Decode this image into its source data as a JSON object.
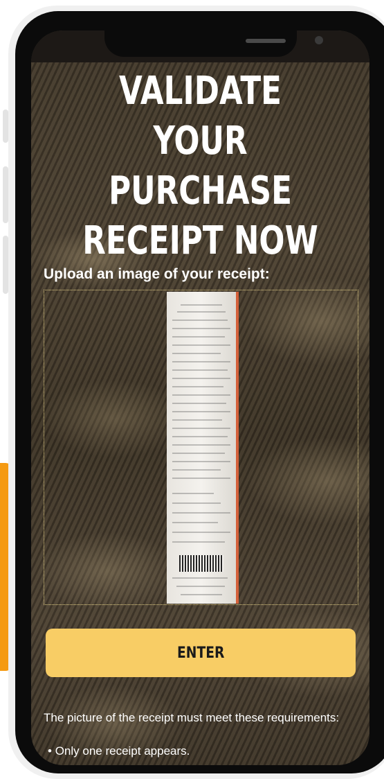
{
  "page": {
    "title_lines": [
      "VALIDATE YOUR",
      "PURCHASE",
      "RECEIPT NOW"
    ],
    "upload_label": "Upload an image of your receipt:",
    "enter_button_label": "ENTER",
    "requirements_intro": "The picture of the receipt must meet these requirements:",
    "requirements": [
      "Only one receipt appears."
    ]
  },
  "colors": {
    "accent_orange": "#f59a12",
    "button_yellow": "#f8cd65",
    "upload_border": "#e9d58a"
  }
}
